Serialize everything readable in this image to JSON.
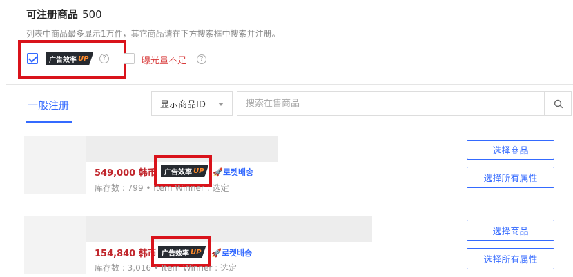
{
  "header": {
    "title": "可注册商品",
    "count": "500",
    "subtitle": "列表中商品最多显示1万件，其它商品请在下方搜索框中搜索并注册。"
  },
  "filters": {
    "ad_badge": {
      "text": "广告效率",
      "up": "UP",
      "checked": true
    },
    "low_exposure": {
      "label": "曝光量不足",
      "checked": false
    },
    "help_glyph": "?"
  },
  "tabs": [
    {
      "label": "一般注册",
      "active": true
    }
  ],
  "search": {
    "select_value": "显示商品ID",
    "placeholder": "搜索在售商品"
  },
  "products": [
    {
      "price": "549,000 韩币",
      "badge_text": "广告效率",
      "badge_up": "UP",
      "rocket": "로켓배송",
      "stock": "库存数 : 799 • Item Winner : 选定",
      "select_label": "选择商品",
      "select_all_label": "选择所有属性"
    },
    {
      "price": "154,840 韩币",
      "badge_text": "广告效率",
      "badge_up": "UP",
      "rocket": "로켓배송",
      "stock": "库存数 : 3,016 • Item Winner : 选定",
      "select_label": "选择商品",
      "select_all_label": "选择所有属性"
    }
  ],
  "colors": {
    "accent": "#346aff",
    "highlight_box": "#d9131b",
    "price": "#c1272d",
    "badge_bg": "#262a30",
    "badge_up": "#ff8a2a"
  },
  "icons": {
    "search": "search-icon",
    "rocket": "rocket-icon",
    "help": "help-circle-icon",
    "caret": "caret-down-icon"
  }
}
